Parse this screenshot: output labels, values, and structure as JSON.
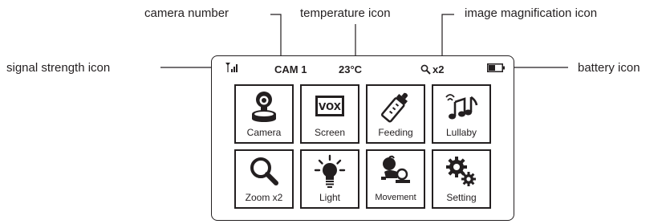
{
  "callouts": {
    "camera_number": "camera number",
    "temperature_icon": "temperature icon",
    "image_magnification_icon": "image magnification icon",
    "signal_strength_icon": "signal strength icon",
    "battery_icon": "battery icon"
  },
  "status_bar": {
    "camera": "CAM 1",
    "temperature": "23°C",
    "zoom": "x2",
    "signal_icon": "signal-strength-icon",
    "zoom_icon": "magnifier-icon",
    "battery_icon": "battery-icon",
    "battery_level": 0.5
  },
  "menu": {
    "items": [
      {
        "label": "Camera",
        "icon": "camera-icon"
      },
      {
        "label": "Screen",
        "icon": "vox-icon",
        "icon_text": "VOX"
      },
      {
        "label": "Feeding",
        "icon": "baby-bottle-icon"
      },
      {
        "label": "Lullaby",
        "icon": "music-notes-icon"
      },
      {
        "label": "Zoom x2",
        "icon": "magnifier-icon"
      },
      {
        "label": "Light",
        "icon": "light-bulb-icon"
      },
      {
        "label": "Movement",
        "icon": "crawling-baby-icon"
      },
      {
        "label": "Setting",
        "icon": "gears-icon"
      }
    ]
  },
  "colors": {
    "ink": "#231f20",
    "background": "#ffffff"
  }
}
